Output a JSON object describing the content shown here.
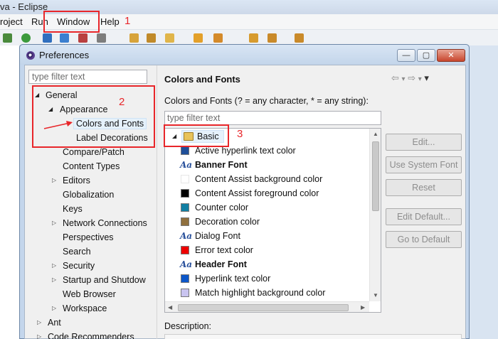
{
  "window": {
    "title": "va - Eclipse"
  },
  "menubar": {
    "items": [
      "roject",
      "Run",
      "Window",
      "Help"
    ]
  },
  "annotations": [
    "1",
    "2",
    "3"
  ],
  "dialog": {
    "title": "Preferences",
    "controls": {
      "minimize": "—",
      "maximize": "▢",
      "close": "✕"
    },
    "left": {
      "filter_placeholder": "type filter text",
      "tree": [
        {
          "label": "General",
          "twisty": "expanded"
        },
        {
          "label": "Appearance",
          "twisty": "expanded"
        },
        {
          "label": "Colors and Fonts",
          "twisty": "none",
          "selected": true
        },
        {
          "label": "Label Decorations",
          "twisty": "none"
        },
        {
          "label": "Compare/Patch",
          "twisty": "none"
        },
        {
          "label": "Content Types",
          "twisty": "none"
        },
        {
          "label": "Editors",
          "twisty": "collapsed"
        },
        {
          "label": "Globalization",
          "twisty": "none"
        },
        {
          "label": "Keys",
          "twisty": "none"
        },
        {
          "label": "Network Connections",
          "twisty": "collapsed"
        },
        {
          "label": "Perspectives",
          "twisty": "none"
        },
        {
          "label": "Search",
          "twisty": "none"
        },
        {
          "label": "Security",
          "twisty": "collapsed"
        },
        {
          "label": "Startup and Shutdow",
          "twisty": "collapsed"
        },
        {
          "label": "Web Browser",
          "twisty": "none"
        },
        {
          "label": "Workspace",
          "twisty": "collapsed"
        },
        {
          "label": "Ant",
          "twisty": "collapsed"
        },
        {
          "label": "Code Recommenders",
          "twisty": "collapsed"
        }
      ]
    },
    "right": {
      "title": "Colors and Fonts",
      "nav_icons": {
        "back": "⇦",
        "back_menu": "▾",
        "forward": "⇨",
        "forward_menu": "▾",
        "view_menu": "▾"
      },
      "description": "Colors and Fonts (? = any character, * = any string):",
      "filter_placeholder": "type filter text",
      "category": "Basic",
      "items": [
        {
          "label": "Active hyperlink text color",
          "kind": "color",
          "color": "#1f4f99"
        },
        {
          "label": "Banner Font",
          "kind": "font"
        },
        {
          "label": "Content Assist background color",
          "kind": "color",
          "color": "#ffffff"
        },
        {
          "label": "Content Assist foreground color",
          "kind": "color",
          "color": "#000000"
        },
        {
          "label": "Counter color",
          "kind": "color",
          "color": "#117fa3"
        },
        {
          "label": "Decoration color",
          "kind": "color",
          "color": "#8f6f3d"
        },
        {
          "label": "Dialog Font",
          "kind": "font"
        },
        {
          "label": "Error text color",
          "kind": "color",
          "color": "#ee0000"
        },
        {
          "label": "Header Font",
          "kind": "font"
        },
        {
          "label": "Hyperlink text color",
          "kind": "color",
          "color": "#0d57c9"
        },
        {
          "label": "Match highlight background color",
          "kind": "color",
          "color": "#c9c4f0"
        }
      ],
      "font_glyph": "Aa",
      "buttons": [
        "Edit...",
        "Use System Font",
        "Reset",
        "Edit Default...",
        "Go to Default"
      ],
      "description_label": "Description:"
    }
  }
}
